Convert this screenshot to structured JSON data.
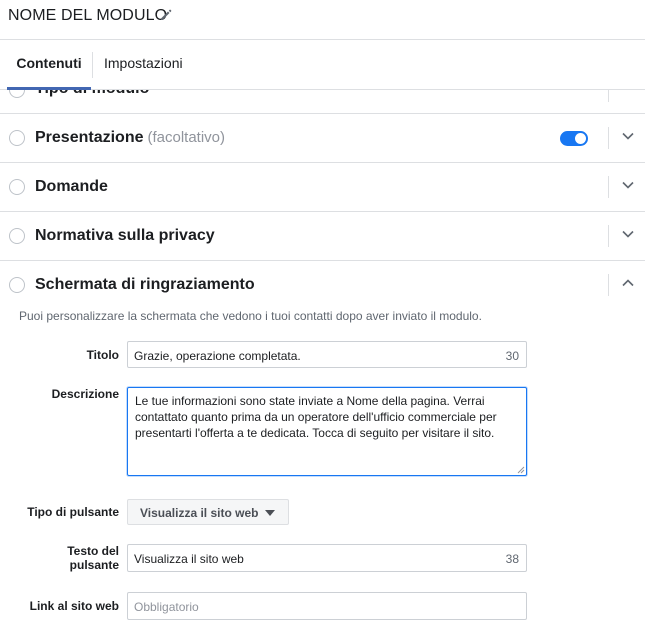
{
  "header": {
    "form_name": "NOME DEL MODULO",
    "edit_icon": "pencil-icon"
  },
  "tabs": [
    {
      "label": "Contenuti",
      "active": true
    },
    {
      "label": "Impostazioni",
      "active": false
    }
  ],
  "sections": {
    "form_type": {
      "title": "Tipo di modulo"
    },
    "intro": {
      "title": "Presentazione",
      "optional": "(facoltativo)",
      "toggle_on": true
    },
    "questions": {
      "title": "Domande"
    },
    "privacy": {
      "title": "Normativa sulla privacy"
    },
    "thank_you": {
      "title": "Schermata di ringraziamento",
      "expanded": true
    }
  },
  "thank_you": {
    "hint": "Puoi personalizzare la schermata che vedono i tuoi contatti dopo aver inviato il modulo.",
    "title_label": "Titolo",
    "title_value": "Grazie, operazione completata.",
    "title_count": "30",
    "description_label": "Descrizione",
    "description_value": "Le tue informazioni sono state inviate a Nome della pagina. Verrai contattato quanto prima da un operatore dell'ufficio commerciale per presentarti l'offerta a te dedicata. Tocca di seguito per visitare il sito.",
    "button_type_label": "Tipo di pulsante",
    "button_type_value": "Visualizza il sito web",
    "button_text_label_1": "Testo del",
    "button_text_label_2": "pulsante",
    "button_text_value": "Visualizza il sito web",
    "button_text_count": "38",
    "link_label": "Link al sito web",
    "link_placeholder": "Obbligatorio"
  },
  "colors": {
    "accent": "#4267b2",
    "toggle": "#1877f2",
    "border": "#dddfe2",
    "muted_text": "#90949c"
  }
}
